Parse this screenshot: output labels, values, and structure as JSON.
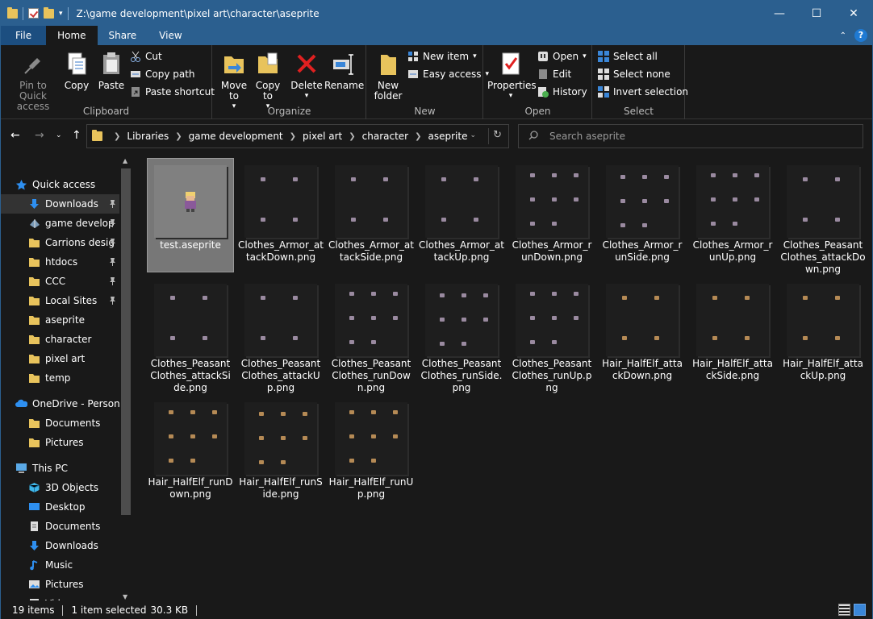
{
  "window": {
    "title": "Z:\\game development\\pixel art\\character\\aseprite"
  },
  "tabs": {
    "file": "File",
    "home": "Home",
    "share": "Share",
    "view": "View",
    "help": "?"
  },
  "ribbon": {
    "clipboard": {
      "label": "Clipboard",
      "pin": "Pin to Quick access",
      "copy": "Copy",
      "paste": "Paste",
      "cut": "Cut",
      "copy_path": "Copy path",
      "paste_shortcut": "Paste shortcut"
    },
    "organize": {
      "label": "Organize",
      "move_to": "Move to",
      "copy_to": "Copy to",
      "delete": "Delete",
      "rename": "Rename"
    },
    "new": {
      "label": "New",
      "new_folder": "New folder",
      "new_item": "New item",
      "easy_access": "Easy access"
    },
    "open": {
      "label": "Open",
      "properties": "Properties",
      "open": "Open",
      "edit": "Edit",
      "history": "History"
    },
    "select": {
      "label": "Select",
      "select_all": "Select all",
      "select_none": "Select none",
      "invert": "Invert selection"
    }
  },
  "breadcrumb": [
    "Libraries",
    "game development",
    "pixel art",
    "character",
    "aseprite"
  ],
  "search": {
    "placeholder": "Search aseprite"
  },
  "nav": [
    {
      "label": "Quick access",
      "icon": "star-icon"
    },
    {
      "label": "Downloads",
      "icon": "download-icon",
      "pinned": true
    },
    {
      "label": "game develop",
      "icon": "library-icon",
      "pinned": true
    },
    {
      "label": "Carrions desig",
      "icon": "folder-icon",
      "pinned": true
    },
    {
      "label": "htdocs",
      "icon": "folder-icon",
      "pinned": true
    },
    {
      "label": "CCC",
      "icon": "folder-icon",
      "pinned": true
    },
    {
      "label": "Local Sites",
      "icon": "folder-icon",
      "pinned": true
    },
    {
      "label": "aseprite",
      "icon": "folder-icon"
    },
    {
      "label": "character",
      "icon": "folder-icon"
    },
    {
      "label": "pixel art",
      "icon": "folder-icon"
    },
    {
      "label": "temp",
      "icon": "folder-icon"
    },
    {
      "label": "OneDrive - Persona",
      "icon": "cloud-icon"
    },
    {
      "label": "Documents",
      "icon": "folder-icon"
    },
    {
      "label": "Pictures",
      "icon": "folder-icon"
    },
    {
      "label": "This PC",
      "icon": "computer-icon"
    },
    {
      "label": "3D Objects",
      "icon": "cube-icon"
    },
    {
      "label": "Desktop",
      "icon": "desktop-icon"
    },
    {
      "label": "Documents",
      "icon": "document-icon"
    },
    {
      "label": "Downloads",
      "icon": "download-icon"
    },
    {
      "label": "Music",
      "icon": "music-icon"
    },
    {
      "label": "Pictures",
      "icon": "pictures-icon"
    },
    {
      "label": "Videos",
      "icon": "video-icon"
    }
  ],
  "files": [
    {
      "name": "test.aseprite"
    },
    {
      "name": "Clothes_Armor_attackDown.png"
    },
    {
      "name": "Clothes_Armor_attackSide.png"
    },
    {
      "name": "Clothes_Armor_attackUp.png"
    },
    {
      "name": "Clothes_Armor_runDown.png"
    },
    {
      "name": "Clothes_Armor_runSide.png"
    },
    {
      "name": "Clothes_Armor_runUp.png"
    },
    {
      "name": "Clothes_PeasantClothes_attackDown.png"
    },
    {
      "name": "Clothes_PeasantClothes_attackSide.png"
    },
    {
      "name": "Clothes_PeasantClothes_attackUp.png"
    },
    {
      "name": "Clothes_PeasantClothes_runDown.png"
    },
    {
      "name": "Clothes_PeasantClothes_runSide.png"
    },
    {
      "name": "Clothes_PeasantClothes_runUp.png"
    },
    {
      "name": "Hair_HalfElf_attackDown.png"
    },
    {
      "name": "Hair_HalfElf_attackSide.png"
    },
    {
      "name": "Hair_HalfElf_attackUp.png"
    },
    {
      "name": "Hair_HalfElf_runDown.png"
    },
    {
      "name": "Hair_HalfElf_runSide.png"
    },
    {
      "name": "Hair_HalfElf_runUp.png"
    }
  ],
  "status": {
    "count": "19 items",
    "selected": "1 item selected",
    "size": "30.3 KB"
  },
  "colors": {
    "titlebar": "#2b5f8f",
    "background": "#191919",
    "folder": "#e8c35c",
    "selection": "#777777"
  }
}
